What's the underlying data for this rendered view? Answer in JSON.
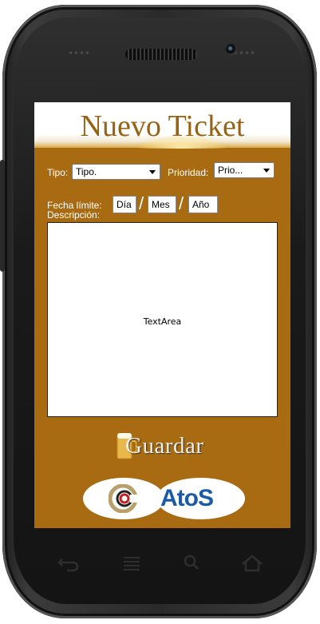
{
  "header": {
    "title": "Nuevo Ticket"
  },
  "form": {
    "tipo_label": "Tipo:",
    "tipo_value": "Tipo.",
    "prioridad_label": "Prioridad:",
    "prioridad_value": "Prio...",
    "fecha_label": "Fecha límite:",
    "dia": "Día",
    "mes": "Mes",
    "anio": "Año",
    "separator": "/",
    "descripcion_label": "Descripción:",
    "textarea_text": "TextArea"
  },
  "actions": {
    "save_label": "Guardar"
  },
  "logos": {
    "brand_text": "AtoS"
  },
  "nav": {
    "icons": [
      "back-icon",
      "menu-icon",
      "search-icon",
      "home-icon"
    ]
  },
  "colors": {
    "screen_bg": "#a86b12",
    "title": "#9a6210",
    "brand": "#1a5aa6"
  }
}
